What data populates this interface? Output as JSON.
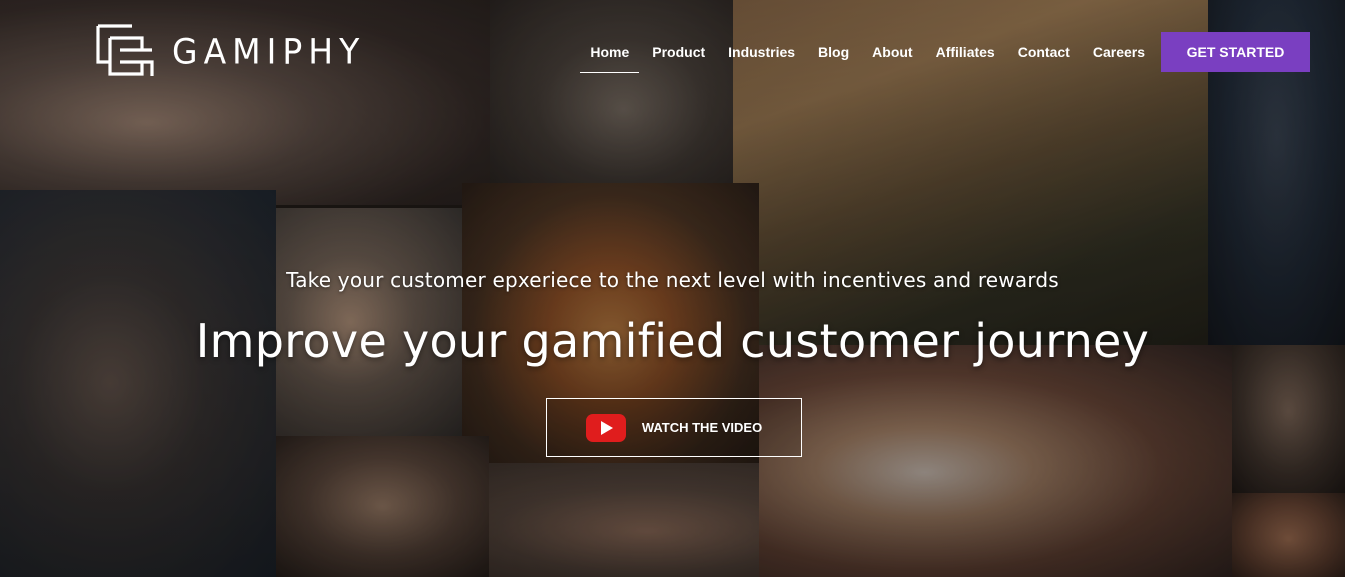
{
  "brand": {
    "name": "GAMIPHY",
    "logo_icon": "gamiphy-logo-icon"
  },
  "nav": {
    "items": [
      {
        "label": "Home",
        "active": true
      },
      {
        "label": "Product",
        "active": false
      },
      {
        "label": "Industries",
        "active": false
      },
      {
        "label": "Blog",
        "active": false
      },
      {
        "label": "About",
        "active": false
      },
      {
        "label": "Affiliates",
        "active": false
      },
      {
        "label": "Contact",
        "active": false
      },
      {
        "label": "Careers",
        "active": false
      }
    ],
    "cta_label": "GET STARTED"
  },
  "hero": {
    "subtitle": "Take your customer epxeriece to the next level with incentives and rewards",
    "title": "Improve your gamified customer journey",
    "video_button": {
      "label": "WATCH THE VIDEO",
      "icon": "youtube-play-icon"
    }
  },
  "colors": {
    "accent": "#7a3fc1",
    "play_icon": "#e01d1d",
    "text": "#ffffff"
  }
}
